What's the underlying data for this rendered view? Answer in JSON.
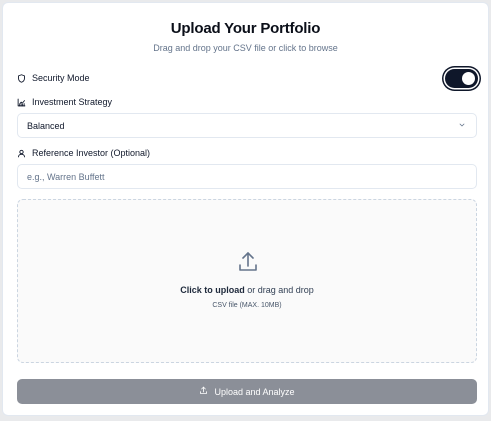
{
  "header": {
    "title": "Upload Your Portfolio",
    "subtitle": "Drag and drop your CSV file or click to browse"
  },
  "security": {
    "label": "Security Mode",
    "icon": "shield-icon",
    "enabled": true
  },
  "strategy": {
    "label": "Investment Strategy",
    "icon": "chart-icon",
    "selected": "Balanced"
  },
  "investor": {
    "label": "Reference Investor (Optional)",
    "icon": "user-icon",
    "placeholder": "e.g., Warren Buffett",
    "value": ""
  },
  "dropzone": {
    "icon": "upload-icon",
    "click_text": "Click to upload",
    "drag_text": " or drag and drop",
    "hint": "CSV file (MAX. 10MB)"
  },
  "submit": {
    "icon": "upload-icon",
    "label": "Upload and Analyze"
  },
  "colors": {
    "primary": "#0f172a",
    "muted_text": "#64748b",
    "border": "#e2e8f0",
    "disabled_button": "#8b8f98"
  }
}
